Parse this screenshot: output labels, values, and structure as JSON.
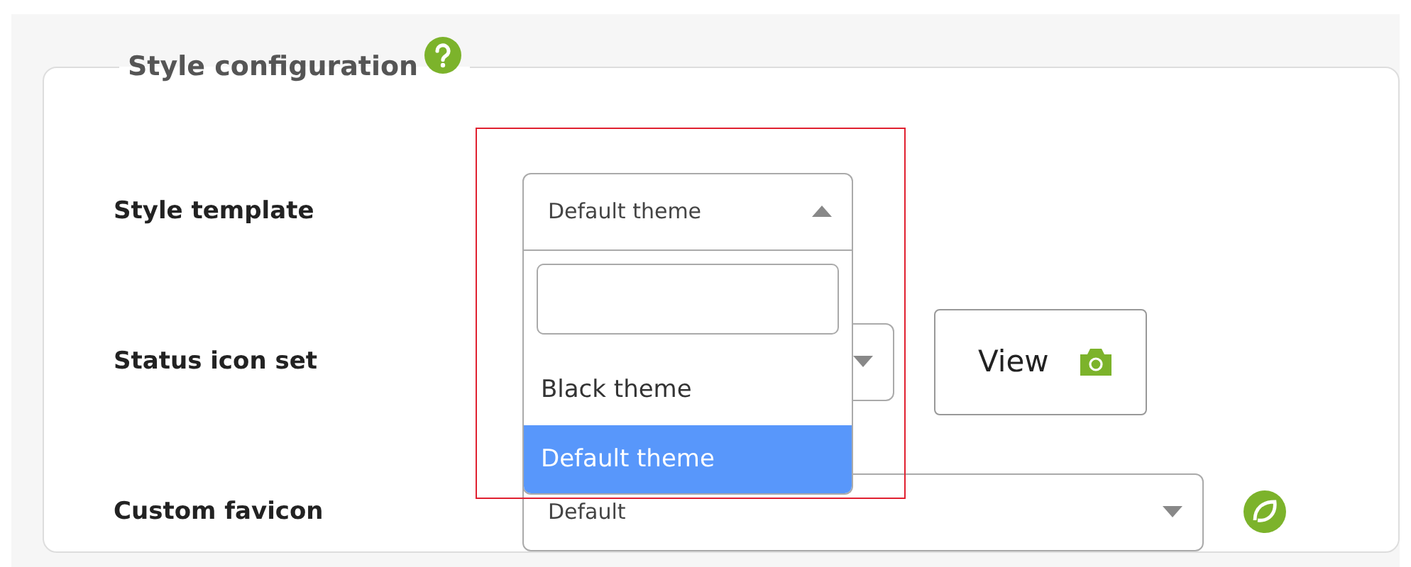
{
  "section": {
    "title": "Style configuration"
  },
  "rows": [
    {
      "label": "Style template",
      "kind": "open-select",
      "value": "Default theme",
      "expanded": true,
      "highlighted": true,
      "options": [
        {
          "label": "Black theme",
          "selected": false
        },
        {
          "label": "Default theme",
          "selected": true
        }
      ]
    },
    {
      "label": "Status icon set",
      "kind": "select-button",
      "button": "View"
    },
    {
      "label": "Custom favicon",
      "kind": "select-icon",
      "value": "Default"
    }
  ]
}
